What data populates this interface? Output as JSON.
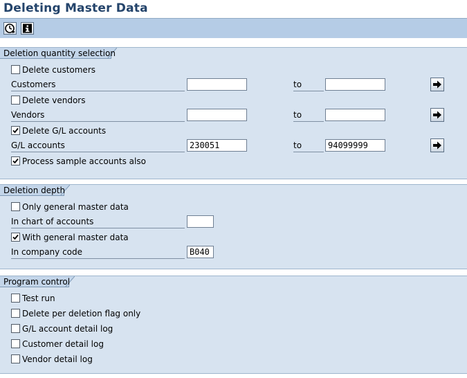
{
  "window": {
    "title": "Deleting Master Data"
  },
  "toolbar": {
    "buttons": [
      {
        "icon": "execute-clock-icon"
      },
      {
        "icon": "information-icon"
      }
    ]
  },
  "sections": {
    "selection": {
      "title": "Deletion quantity selection",
      "delete_customers": {
        "label": "Delete customers",
        "checked": false
      },
      "customers": {
        "label": "Customers",
        "from": "",
        "to_label": "to",
        "to": ""
      },
      "delete_vendors": {
        "label": "Delete vendors",
        "checked": false
      },
      "vendors": {
        "label": "Vendors",
        "from": "",
        "to_label": "to",
        "to": ""
      },
      "delete_gl": {
        "label": "Delete G/L accounts",
        "checked": true
      },
      "gl_accounts": {
        "label": "G/L accounts",
        "from": "230051",
        "to_label": "to",
        "to": "94099999"
      },
      "sample_accounts": {
        "label": "Process sample accounts also",
        "checked": true
      }
    },
    "depth": {
      "title": "Deletion depth",
      "only_general": {
        "label": "Only general master data",
        "checked": false
      },
      "chart_of_accounts": {
        "label": "In chart of accounts",
        "value": ""
      },
      "with_general": {
        "label": "With general master data",
        "checked": true
      },
      "company_code": {
        "label": "In company code",
        "value": "B040"
      }
    },
    "control": {
      "title": "Program control",
      "test_run": {
        "label": "Test run",
        "checked": false
      },
      "deletion_flag": {
        "label": "Delete per deletion flag only",
        "checked": false
      },
      "gl_log": {
        "label": "G/L account detail log",
        "checked": false
      },
      "customer_log": {
        "label": "Customer detail log",
        "checked": false
      },
      "vendor_log": {
        "label": "Vendor detail log",
        "checked": false
      }
    }
  },
  "colors": {
    "title": "#24446b",
    "toolbar": "#b5cce6",
    "section_bg": "#d7e3f0"
  }
}
